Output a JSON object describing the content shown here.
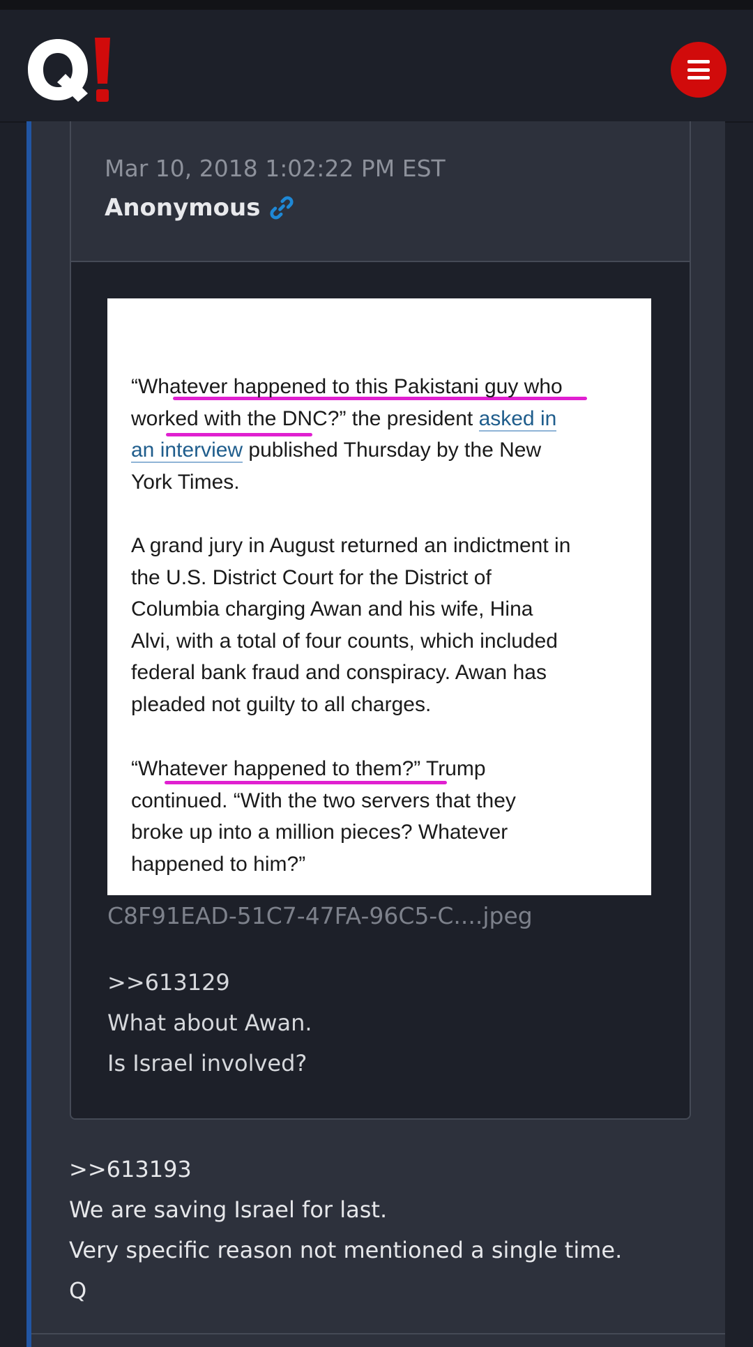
{
  "header": {
    "logo_icon": "q-exclamation-logo",
    "menu_icon": "hamburger-menu-icon",
    "accent_color": "#d10b0b"
  },
  "quoted_post": {
    "date": "Mar 10, 2018 1:02:22 PM EST",
    "author": "Anonymous",
    "link_icon": "link-icon",
    "image": {
      "paragraph_1": [
        "“Whatever happened to this Pakistani guy who",
        "worked with the DNC?” the president ",
        "asked in",
        "an interview",
        " published Thursday by the New",
        "York Times."
      ],
      "paragraph_2": [
        "A grand jury in August returned an indictment in",
        "the U.S. District Court for the District of",
        "Columbia charging Awan and his wife, Hina",
        "Alvi, with a total of four counts, which included",
        "federal bank fraud and conspiracy. Awan has",
        "pleaded not guilty to all charges."
      ],
      "paragraph_3": [
        "“Whatever happened to them?” Trump",
        "continued. “With the two servers that they",
        "broke up into a million pieces? Whatever",
        "happened to him?”"
      ],
      "highlight_color": "#e020d0"
    },
    "file_name": "C8F91EAD-51C7-47FA-96C5-C....jpeg",
    "lines": [
      ">>613129",
      "What about Awan.",
      "Is Israel involved?"
    ]
  },
  "post": {
    "lines": [
      ">>613193",
      "We are saving Israel for last.",
      "Very specific reason not mentioned a single time.",
      "Q"
    ]
  }
}
